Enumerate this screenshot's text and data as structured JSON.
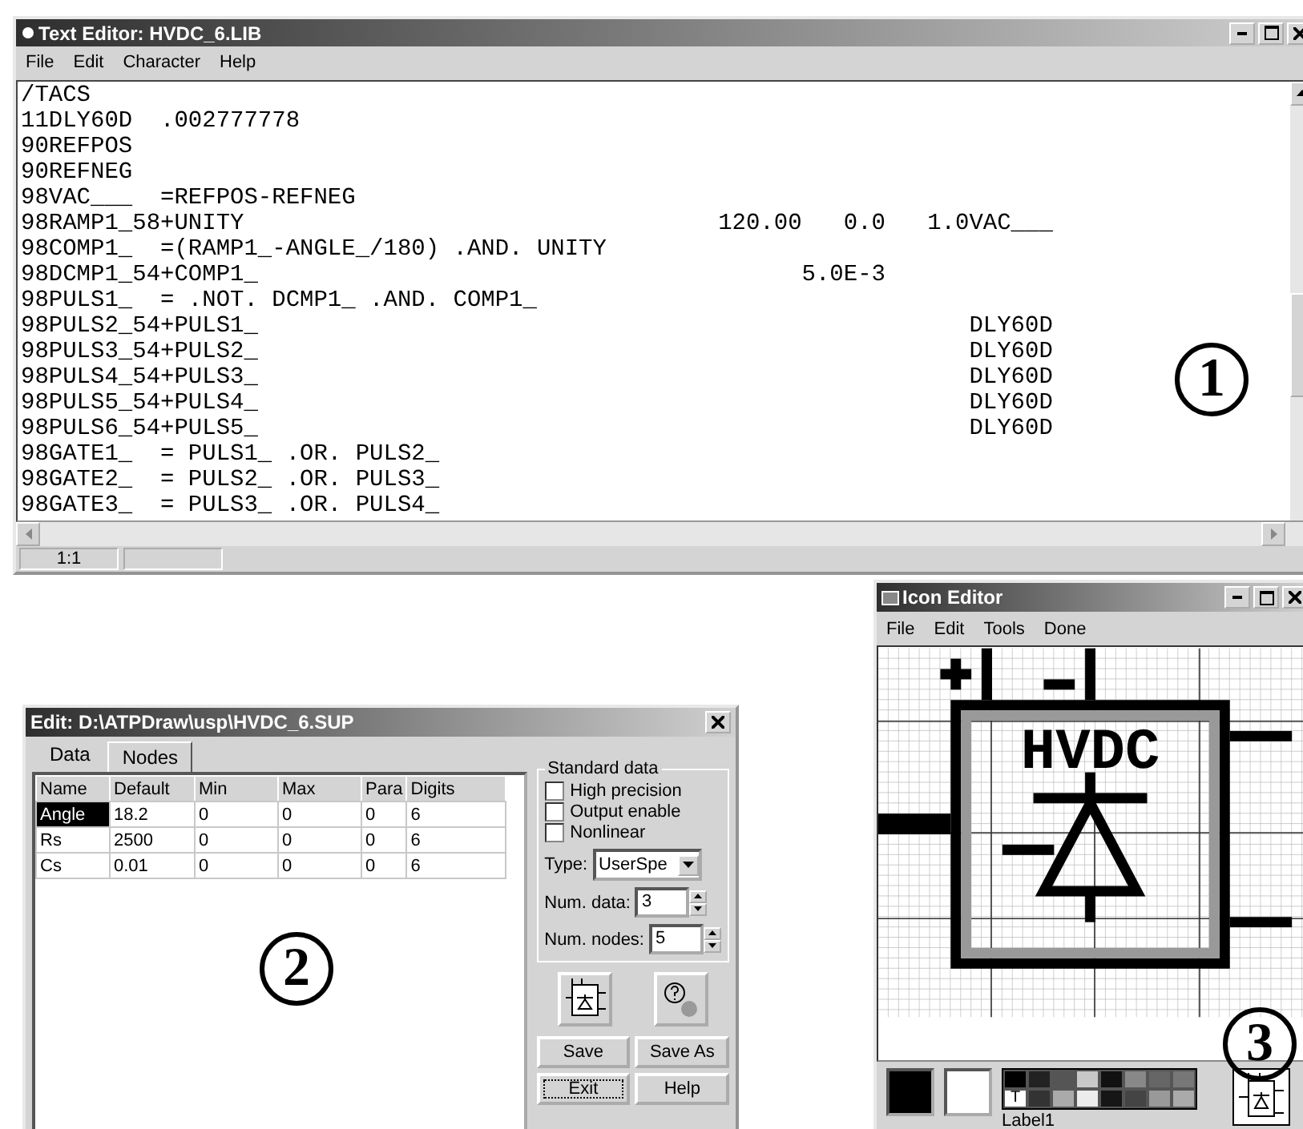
{
  "text_editor": {
    "title": "Text Editor: HVDC_6.LIB",
    "menu": [
      "File",
      "Edit",
      "Character",
      "Help"
    ],
    "lines": [
      "/TACS",
      "11DLY60D  .002777778",
      "90REFPOS",
      "90REFNEG",
      "98VAC___  =REFPOS-REFNEG",
      "98RAMP1_58+UNITY                                  120.00   0.0   1.0VAC___",
      "98COMP1_  =(RAMP1_-ANGLE_/180) .AND. UNITY",
      "98DCMP1_54+COMP1_                                       5.0E-3",
      "98PULS1_  = .NOT. DCMP1_ .AND. COMP1_",
      "98PULS2_54+PULS1_                                                   DLY60D",
      "98PULS3_54+PULS2_                                                   DLY60D",
      "98PULS4_54+PULS3_                                                   DLY60D",
      "98PULS5_54+PULS4_                                                   DLY60D",
      "98PULS6_54+PULS5_                                                   DLY60D",
      "98GATE1_  = PULS1_ .OR. PULS2_",
      "98GATE2_  = PULS2_ .OR. PULS3_",
      "98GATE3_  = PULS3_ .OR. PULS4_"
    ],
    "status": "1:1",
    "callout": "1"
  },
  "edit_dialog": {
    "title": "Edit: D:\\ATPDraw\\usp\\HVDC_6.SUP",
    "tabs": [
      {
        "label": "Data",
        "selected": true
      },
      {
        "label": "Nodes",
        "selected": false
      }
    ],
    "table": {
      "columns": [
        "Name",
        "Default",
        "Min",
        "Max",
        "Para",
        "Digits"
      ],
      "rows": [
        {
          "cells": [
            "Angle",
            "18.2",
            "0",
            "0",
            "0",
            "6"
          ],
          "selected": true
        },
        {
          "cells": [
            "Rs",
            "2500",
            "0",
            "0",
            "0",
            "6"
          ],
          "selected": false
        },
        {
          "cells": [
            "Cs",
            "0.01",
            "0",
            "0",
            "0",
            "6"
          ],
          "selected": false
        }
      ]
    },
    "group": {
      "title": "Standard data",
      "checkboxes": [
        {
          "label": "High precision",
          "checked": false
        },
        {
          "label": "Output enable",
          "checked": false
        },
        {
          "label": "Nonlinear",
          "checked": false
        }
      ],
      "type_label": "Type:",
      "type_value": "UserSpe",
      "spinners": [
        {
          "label": "Num. data:",
          "value": "3"
        },
        {
          "label": "Num. nodes:",
          "value": "5"
        }
      ]
    },
    "buttons": [
      "Save",
      "Save As",
      "Exit",
      "Help"
    ],
    "callout": "2"
  },
  "icon_editor": {
    "title": "Icon Editor",
    "menu": [
      "File",
      "Edit",
      "Tools",
      "Done"
    ],
    "canvas_text": "HVDC",
    "palette_mark": "T",
    "label": "Label1",
    "callout": "3"
  }
}
